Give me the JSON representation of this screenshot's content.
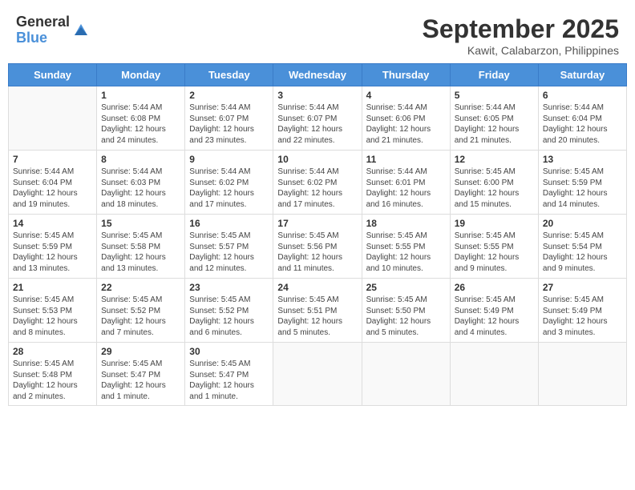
{
  "header": {
    "logo_general": "General",
    "logo_blue": "Blue",
    "month_title": "September 2025",
    "location": "Kawit, Calabarzon, Philippines"
  },
  "days_of_week": [
    "Sunday",
    "Monday",
    "Tuesday",
    "Wednesday",
    "Thursday",
    "Friday",
    "Saturday"
  ],
  "weeks": [
    [
      {
        "day": "",
        "info": ""
      },
      {
        "day": "1",
        "info": "Sunrise: 5:44 AM\nSunset: 6:08 PM\nDaylight: 12 hours\nand 24 minutes."
      },
      {
        "day": "2",
        "info": "Sunrise: 5:44 AM\nSunset: 6:07 PM\nDaylight: 12 hours\nand 23 minutes."
      },
      {
        "day": "3",
        "info": "Sunrise: 5:44 AM\nSunset: 6:07 PM\nDaylight: 12 hours\nand 22 minutes."
      },
      {
        "day": "4",
        "info": "Sunrise: 5:44 AM\nSunset: 6:06 PM\nDaylight: 12 hours\nand 21 minutes."
      },
      {
        "day": "5",
        "info": "Sunrise: 5:44 AM\nSunset: 6:05 PM\nDaylight: 12 hours\nand 21 minutes."
      },
      {
        "day": "6",
        "info": "Sunrise: 5:44 AM\nSunset: 6:04 PM\nDaylight: 12 hours\nand 20 minutes."
      }
    ],
    [
      {
        "day": "7",
        "info": "Sunrise: 5:44 AM\nSunset: 6:04 PM\nDaylight: 12 hours\nand 19 minutes."
      },
      {
        "day": "8",
        "info": "Sunrise: 5:44 AM\nSunset: 6:03 PM\nDaylight: 12 hours\nand 18 minutes."
      },
      {
        "day": "9",
        "info": "Sunrise: 5:44 AM\nSunset: 6:02 PM\nDaylight: 12 hours\nand 17 minutes."
      },
      {
        "day": "10",
        "info": "Sunrise: 5:44 AM\nSunset: 6:02 PM\nDaylight: 12 hours\nand 17 minutes."
      },
      {
        "day": "11",
        "info": "Sunrise: 5:44 AM\nSunset: 6:01 PM\nDaylight: 12 hours\nand 16 minutes."
      },
      {
        "day": "12",
        "info": "Sunrise: 5:45 AM\nSunset: 6:00 PM\nDaylight: 12 hours\nand 15 minutes."
      },
      {
        "day": "13",
        "info": "Sunrise: 5:45 AM\nSunset: 5:59 PM\nDaylight: 12 hours\nand 14 minutes."
      }
    ],
    [
      {
        "day": "14",
        "info": "Sunrise: 5:45 AM\nSunset: 5:59 PM\nDaylight: 12 hours\nand 13 minutes."
      },
      {
        "day": "15",
        "info": "Sunrise: 5:45 AM\nSunset: 5:58 PM\nDaylight: 12 hours\nand 13 minutes."
      },
      {
        "day": "16",
        "info": "Sunrise: 5:45 AM\nSunset: 5:57 PM\nDaylight: 12 hours\nand 12 minutes."
      },
      {
        "day": "17",
        "info": "Sunrise: 5:45 AM\nSunset: 5:56 PM\nDaylight: 12 hours\nand 11 minutes."
      },
      {
        "day": "18",
        "info": "Sunrise: 5:45 AM\nSunset: 5:55 PM\nDaylight: 12 hours\nand 10 minutes."
      },
      {
        "day": "19",
        "info": "Sunrise: 5:45 AM\nSunset: 5:55 PM\nDaylight: 12 hours\nand 9 minutes."
      },
      {
        "day": "20",
        "info": "Sunrise: 5:45 AM\nSunset: 5:54 PM\nDaylight: 12 hours\nand 9 minutes."
      }
    ],
    [
      {
        "day": "21",
        "info": "Sunrise: 5:45 AM\nSunset: 5:53 PM\nDaylight: 12 hours\nand 8 minutes."
      },
      {
        "day": "22",
        "info": "Sunrise: 5:45 AM\nSunset: 5:52 PM\nDaylight: 12 hours\nand 7 minutes."
      },
      {
        "day": "23",
        "info": "Sunrise: 5:45 AM\nSunset: 5:52 PM\nDaylight: 12 hours\nand 6 minutes."
      },
      {
        "day": "24",
        "info": "Sunrise: 5:45 AM\nSunset: 5:51 PM\nDaylight: 12 hours\nand 5 minutes."
      },
      {
        "day": "25",
        "info": "Sunrise: 5:45 AM\nSunset: 5:50 PM\nDaylight: 12 hours\nand 5 minutes."
      },
      {
        "day": "26",
        "info": "Sunrise: 5:45 AM\nSunset: 5:49 PM\nDaylight: 12 hours\nand 4 minutes."
      },
      {
        "day": "27",
        "info": "Sunrise: 5:45 AM\nSunset: 5:49 PM\nDaylight: 12 hours\nand 3 minutes."
      }
    ],
    [
      {
        "day": "28",
        "info": "Sunrise: 5:45 AM\nSunset: 5:48 PM\nDaylight: 12 hours\nand 2 minutes."
      },
      {
        "day": "29",
        "info": "Sunrise: 5:45 AM\nSunset: 5:47 PM\nDaylight: 12 hours\nand 1 minute."
      },
      {
        "day": "30",
        "info": "Sunrise: 5:45 AM\nSunset: 5:47 PM\nDaylight: 12 hours\nand 1 minute."
      },
      {
        "day": "",
        "info": ""
      },
      {
        "day": "",
        "info": ""
      },
      {
        "day": "",
        "info": ""
      },
      {
        "day": "",
        "info": ""
      }
    ]
  ]
}
